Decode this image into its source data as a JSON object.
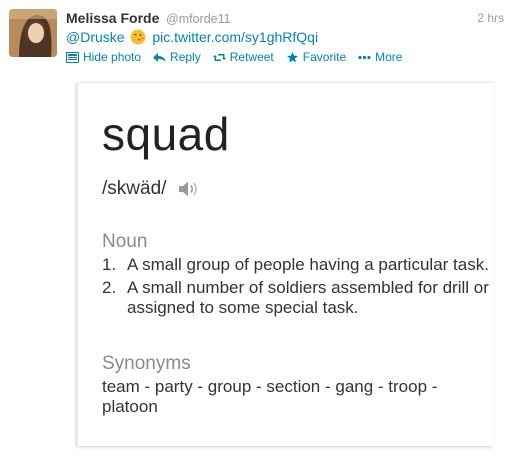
{
  "tweet": {
    "name": "Melissa Forde",
    "handle": "@mforde11",
    "time": "2 hrs",
    "mention": "@Druske",
    "link": "pic.twitter.com/sy1ghRfQqi",
    "emoji": "kissing-face-emoji"
  },
  "actions": {
    "hide_photo": "Hide photo",
    "reply": "Reply",
    "retweet": "Retweet",
    "favorite": "Favorite",
    "more": "More"
  },
  "photo": {
    "word": "squad",
    "pronunciation": "/skwäd/",
    "part_of_speech": "Noun",
    "definitions": [
      {
        "num": "1.",
        "text": "A small group of people having a particular task."
      },
      {
        "num": "2.",
        "text": "A small number of soldiers assembled for drill or assigned to some special task."
      }
    ],
    "synonyms_heading": "Synonyms",
    "synonyms": "team - party - group - section - gang - troop - platoon"
  },
  "colors": {
    "link": "#0084b4",
    "muted": "#999999",
    "text": "#333333"
  }
}
